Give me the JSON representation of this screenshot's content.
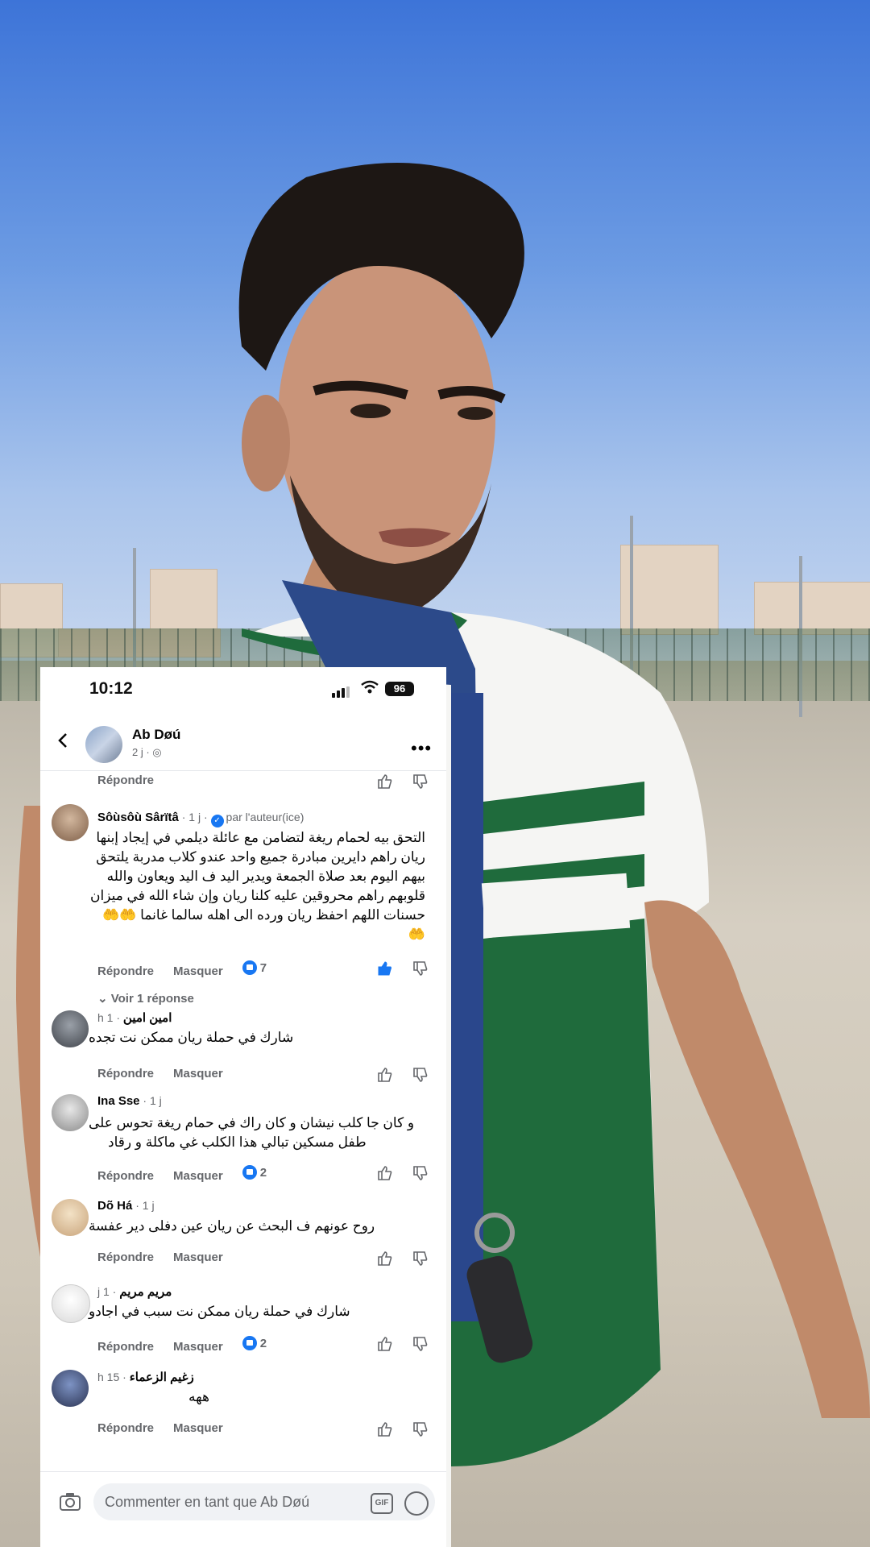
{
  "status": {
    "time": "10:12",
    "battery": "96"
  },
  "post_header": {
    "name": "Ab Døú",
    "subtitle": "2 j ·"
  },
  "actions": {
    "reply": "Répondre",
    "hide": "Masquer"
  },
  "top_row": {
    "reply": "Répondre"
  },
  "comments": [
    {
      "name": "Sôùsôù Sârïtâ",
      "meta": " · 1 j · ",
      "badge": "par l'auteur(ice)",
      "text_lines": [
        "التحق بيه لحمام ريغة لتضامن مع عائلة ديلمي في إيجاد إبنها",
        "ريان راهم دايرين مبادرة جميع واحد عندو كلاب مدربة يلتحق",
        "بيهم اليوم بعد صلاة الجمعة  ويدير اليد ف اليد ويعاون والله",
        "قلوبهم راهم محروقين  عليه كلنا ريان وإن شاء الله في ميزان",
        "حسنات اللهم احفظ ريان ورده الى اهله سالما غانما 🤲🤲",
        "🤲"
      ],
      "likes": "7",
      "replies": "Voir 1 réponse"
    },
    {
      "name": "امين امين",
      "meta": "h 1 · ",
      "text_lines": [
        "شارك في حملة ريان ممكن نت تجده"
      ]
    },
    {
      "name": "Ina Sse",
      "meta": " · 1 j",
      "text_lines": [
        "و كان جا كلب نيشان و كان راك في حمام ريغة تحوس على",
        "طفل مسكين تبالي هذا الكلب غي ماكلة و رقاد"
      ],
      "likes": "2"
    },
    {
      "name": "Dõ Há",
      "meta": " · 1 j",
      "text_lines": [
        "روح عونهم ف البحث عن ريان عين دفلى دير عفسة"
      ]
    },
    {
      "name": "مريم مريم",
      "meta": "j 1 · ",
      "text_lines": [
        "شارك في حملة ريان ممكن نت سبب في اجادو"
      ],
      "likes": "2"
    },
    {
      "name": "زغيم الزعماء",
      "meta": "h 15 · ",
      "text_lines": [
        "ههه"
      ]
    }
  ],
  "composer": {
    "placeholder": "Commenter en tant que Ab Døú",
    "gif": "GIF"
  },
  "colors": {
    "accent": "#1877f2",
    "text": "#050505",
    "muted": "#65676b"
  },
  "icons": [
    "back-arrow-icon",
    "more-icon",
    "like-icon",
    "dislike-icon",
    "camera-icon",
    "gif-icon",
    "emoji-icon",
    "globe-icon",
    "chevron-down-icon"
  ]
}
